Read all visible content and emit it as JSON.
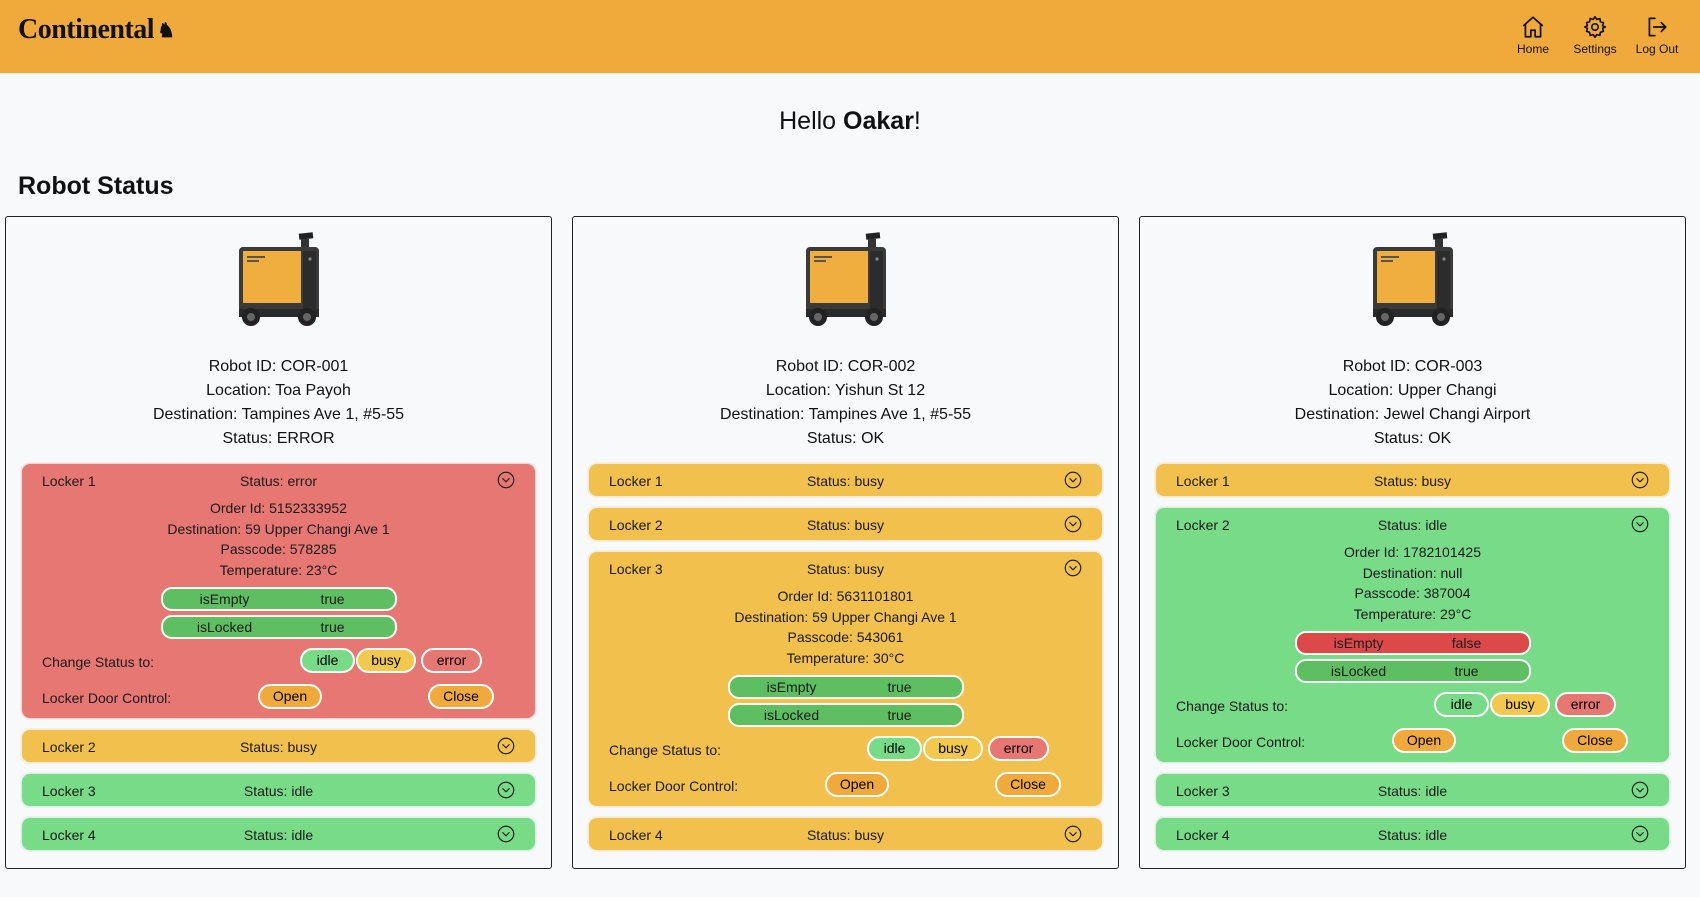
{
  "header": {
    "brand": "Continental",
    "nav": [
      {
        "label": "Home",
        "icon": "home-icon"
      },
      {
        "label": "Settings",
        "icon": "gear-icon"
      },
      {
        "label": "Log Out",
        "icon": "logout-icon"
      }
    ]
  },
  "greeting": {
    "prefix": "Hello ",
    "name": "Oakar",
    "suffix": "!"
  },
  "section_title": "Robot Status",
  "labels": {
    "change_status": "Change Status to:",
    "door_control": "Locker Door Control:",
    "idle": "idle",
    "busy": "busy",
    "error": "error",
    "open": "Open",
    "close": "Close"
  },
  "robots": [
    {
      "id_line": "Robot ID: COR-001",
      "location_line": "Location: Toa Payoh",
      "destination_line": "Destination: Tampines Ave 1, #5-55",
      "status_line": "Status: ERROR",
      "lockers": [
        {
          "name": "Locker 1",
          "status": "Status: error",
          "color": "#e77773",
          "order_id": "Order Id: 5152333952",
          "destination": "Destination: 59 Upper Changi Ave 1",
          "passcode": "Passcode: 578285",
          "temperature": "Temperature: 23°C",
          "is_empty_key": "isEmpty",
          "is_empty": "true",
          "is_locked_key": "isLocked",
          "is_locked": "true"
        },
        {
          "name": "Locker 2",
          "status": "Status: busy",
          "color": "#f2c04c"
        },
        {
          "name": "Locker 3",
          "status": "Status: idle",
          "color": "#78db87"
        },
        {
          "name": "Locker 4",
          "status": "Status: idle",
          "color": "#78db87"
        }
      ]
    },
    {
      "id_line": "Robot ID: COR-002",
      "location_line": "Location: Yishun St 12",
      "destination_line": "Destination: Tampines Ave 1, #5-55",
      "status_line": "Status: OK",
      "lockers": [
        {
          "name": "Locker 1",
          "status": "Status: busy",
          "color": "#f2c04c"
        },
        {
          "name": "Locker 2",
          "status": "Status: busy",
          "color": "#f2c04c"
        },
        {
          "name": "Locker 3",
          "status": "Status: busy",
          "color": "#f2c04c",
          "order_id": "Order Id: 5631101801",
          "destination": "Destination: 59 Upper Changi Ave 1",
          "passcode": "Passcode: 543061",
          "temperature": "Temperature: 30°C",
          "is_empty_key": "isEmpty",
          "is_empty": "true",
          "is_locked_key": "isLocked",
          "is_locked": "true"
        },
        {
          "name": "Locker 4",
          "status": "Status: busy",
          "color": "#f2c04c"
        }
      ]
    },
    {
      "id_line": "Robot ID: COR-003",
      "location_line": "Location: Upper Changi",
      "destination_line": "Destination: Jewel Changi Airport",
      "status_line": "Status: OK",
      "lockers": [
        {
          "name": "Locker 1",
          "status": "Status: busy",
          "color": "#f2c04c"
        },
        {
          "name": "Locker 2",
          "status": "Status: idle",
          "color": "#78db87",
          "order_id": "Order Id: 1782101425",
          "destination": "Destination: null",
          "passcode": "Passcode: 387004",
          "temperature": "Temperature: 29°C",
          "is_empty_key": "isEmpty",
          "is_empty": "false",
          "is_locked_key": "isLocked",
          "is_locked": "true"
        },
        {
          "name": "Locker 3",
          "status": "Status: idle",
          "color": "#78db87"
        },
        {
          "name": "Locker 4",
          "status": "Status: idle",
          "color": "#78db87"
        }
      ]
    }
  ]
}
